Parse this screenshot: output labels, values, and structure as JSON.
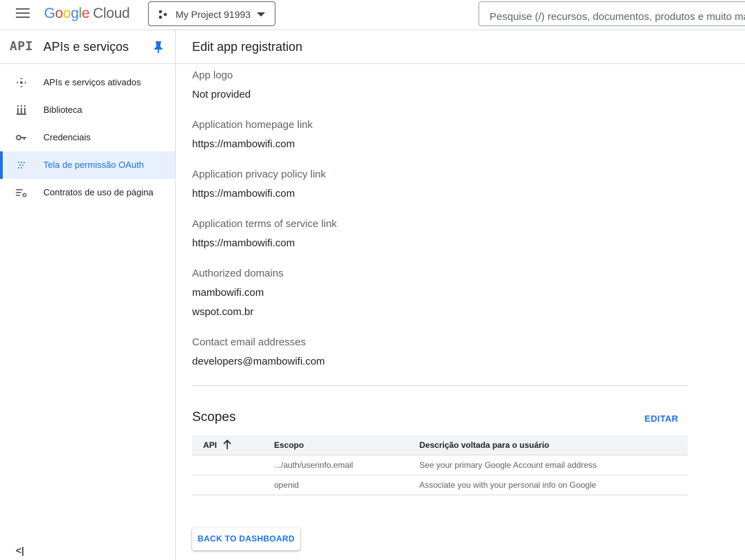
{
  "header": {
    "logo": {
      "G": "G",
      "o1": "o",
      "o2": "o",
      "g": "g",
      "l": "l",
      "e": "e",
      "cloud": "Cloud"
    },
    "project_name": "My Project 91993",
    "search_placeholder": "Pesquise (/) recursos, documentos, produtos e muito mais"
  },
  "sidebar": {
    "badge": "API",
    "title": "APIs e serviços",
    "items": [
      {
        "label": "APIs e serviços ativados",
        "icon": "diamond-arrows-icon",
        "active": false
      },
      {
        "label": "Biblioteca",
        "icon": "library-icon",
        "active": false
      },
      {
        "label": "Credenciais",
        "icon": "key-icon",
        "active": false
      },
      {
        "label": "Tela de permissão OAuth",
        "icon": "dots-grid-icon",
        "active": true
      },
      {
        "label": "Contratos de uso de página",
        "icon": "settings-list-icon",
        "active": false
      }
    ],
    "collapse": "<|"
  },
  "main": {
    "title": "Edit app registration",
    "fields": [
      {
        "label": "App logo",
        "values": [
          "Not provided"
        ]
      },
      {
        "label": "Application homepage link",
        "values": [
          "https://mambowifi.com"
        ]
      },
      {
        "label": "Application privacy policy link",
        "values": [
          "https://mambowifi.com"
        ]
      },
      {
        "label": "Application terms of service link",
        "values": [
          "https://mambowifi.com"
        ]
      },
      {
        "label": "Authorized domains",
        "values": [
          "mambowifi.com",
          "wspot.com.br"
        ]
      },
      {
        "label": "Contact email addresses",
        "values": [
          "developers@mambowifi.com"
        ]
      }
    ],
    "scopes": {
      "title": "Scopes",
      "edit_label": "EDITAR",
      "columns": [
        "API",
        "Escopo",
        "Descrição voltada para o usuário"
      ],
      "rows": [
        [
          "",
          ".../auth/userinfo.email",
          "See your primary Google Account email address"
        ],
        [
          "",
          "openid",
          "Associate you with your personal info on Google"
        ]
      ]
    },
    "back_button": "BACK TO DASHBOARD"
  },
  "colors": {
    "accent": "#1a73e8",
    "active_bg": "#e8f0fe",
    "divider": "#dadce0"
  }
}
